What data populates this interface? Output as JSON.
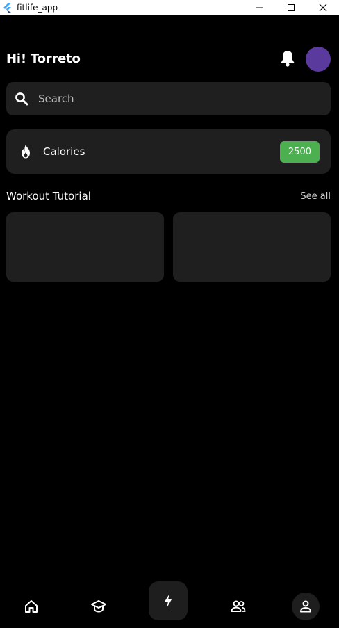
{
  "window": {
    "title": "fitlife_app"
  },
  "header": {
    "greeting": "Hi! Torreto",
    "avatar_color": "#5a3a9c"
  },
  "search": {
    "placeholder": "Search",
    "value": ""
  },
  "calories": {
    "label": "Calories",
    "value": "2500",
    "badge_color": "#4caf50"
  },
  "workout_section": {
    "title": "Workout Tutorial",
    "see_all": "See all"
  },
  "bottom_nav": {
    "items": [
      "home-icon",
      "school-icon",
      "bolt-icon",
      "people-icon",
      "person-icon"
    ]
  }
}
